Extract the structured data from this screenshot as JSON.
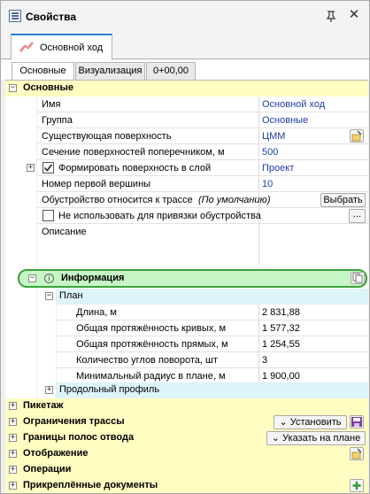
{
  "window": {
    "title": "Свойства"
  },
  "doc_tab": {
    "label": "Основной ход"
  },
  "tabs": [
    "Основные",
    "Визуализация",
    "0+00,00"
  ],
  "sections": {
    "main": "Основные",
    "piketazh": "Пикетаж",
    "constraints": "Ограничения трассы",
    "strips": "Границы полос отвода",
    "display": "Отображение",
    "operations": "Операции",
    "attached": "Прикреплённые документы"
  },
  "props": {
    "name": {
      "label": "Имя",
      "value": "Основной ход"
    },
    "group": {
      "label": "Группа",
      "value": "Основные"
    },
    "surface": {
      "label": "Существующая поверхность",
      "value": "ЦММ"
    },
    "section": {
      "label": "Сечение поверхностей поперечником, м",
      "value": "500"
    },
    "form_surface": {
      "label": "Формировать поверхность в слой",
      "value": "Проект",
      "checked": true
    },
    "first_vertex": {
      "label": "Номер первой вершины",
      "value": "10"
    },
    "arrangement": {
      "label": "Обустройство относится к трассе",
      "note": "(По умолчанию)",
      "button": "Выбрать"
    },
    "no_bind": {
      "label": "Не использовать для привязки обустройства",
      "checked": false,
      "button": "..."
    },
    "description": {
      "label": "Описание",
      "value": ""
    }
  },
  "info": {
    "title": "Информация",
    "plan": "План",
    "rows": [
      {
        "label": "Длина, м",
        "value": "2 831,88"
      },
      {
        "label": "Общая протяжённость кривых, м",
        "value": "1 577,32"
      },
      {
        "label": "Общая протяжённость прямых, м",
        "value": "1 254,55"
      },
      {
        "label": "Количество углов поворота, шт",
        "value": "3"
      },
      {
        "label": "Минимальный радиус в плане, м",
        "value": "1 900,00"
      }
    ],
    "profile": "Продольный профиль"
  },
  "actions": {
    "install": "Установить",
    "specify": "Указать на плане"
  },
  "colors": {
    "band": "#fffdc2",
    "subband": "#ddf4f8",
    "info": "#c6f5c6",
    "info_border": "#3aa33a",
    "value_text": "#1f3ca8",
    "accent": "#2a7fd4"
  },
  "icons": [
    "properties-icon",
    "pin-icon",
    "close-icon",
    "route-icon",
    "info-icon",
    "copy-icon",
    "save-icon",
    "settings-icon",
    "add-icon"
  ]
}
